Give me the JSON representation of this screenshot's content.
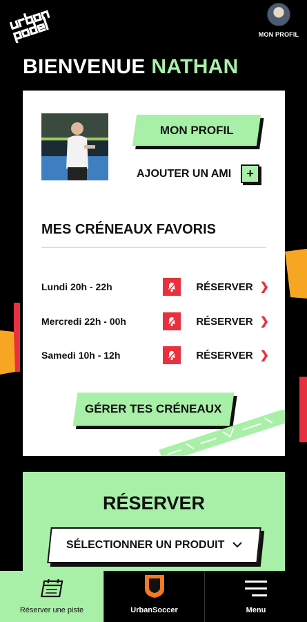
{
  "header": {
    "logo_text": "urban padel",
    "profile_label": "MON PROFIL"
  },
  "welcome": {
    "greeting": "BIENVENUE",
    "name": "NATHAN"
  },
  "card": {
    "profile_button": "MON PROFIL",
    "add_friend_label": "AJOUTER UN AMI",
    "add_friend_icon": "+",
    "favorites_title": "MES CRÉNEAUX FAVORIS",
    "slots": [
      {
        "time": "Lundi 20h - 22h",
        "action": "RÉSERVER"
      },
      {
        "time": "Mercredi 22h - 00h",
        "action": "RÉSERVER"
      },
      {
        "time": "Samedi 10h - 12h",
        "action": "RÉSERVER"
      }
    ],
    "manage_button": "GÉRER TES CRÉNEAUX"
  },
  "reserve": {
    "title": "RÉSERVER",
    "select_label": "SÉLECTIONNER UN PRODUIT"
  },
  "bottom_nav": {
    "items": [
      {
        "label": "Réserver une piste",
        "icon": "calendar-icon"
      },
      {
        "label": "UrbanSoccer",
        "icon": "urbansoccer-shield-icon"
      },
      {
        "label": "Menu",
        "icon": "hamburger-icon"
      }
    ]
  },
  "colors": {
    "accent_green": "#a8f0a8",
    "accent_red": "#e8313e",
    "accent_orange": "#f6a623",
    "background": "#000000"
  }
}
